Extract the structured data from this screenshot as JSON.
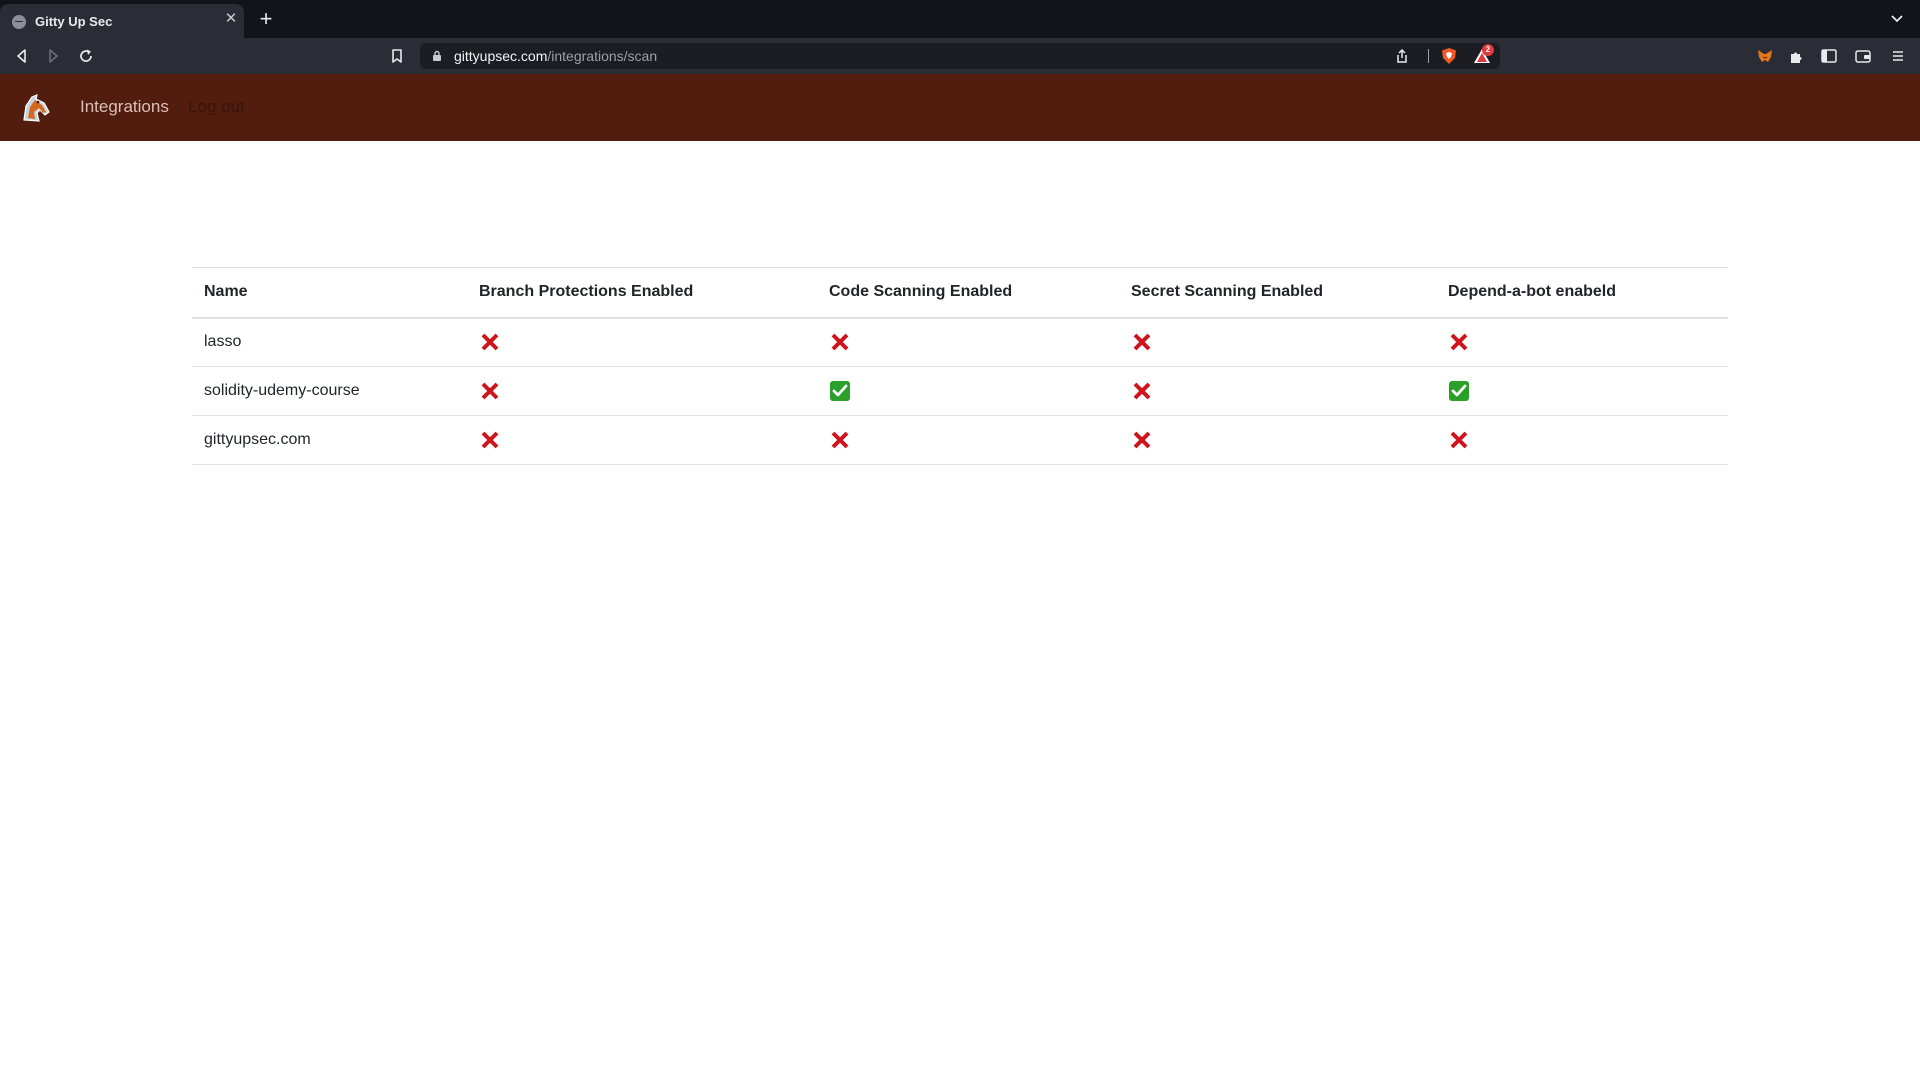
{
  "browser": {
    "tab_title": "Gitty Up Sec",
    "url_host": "gittyupsec.com",
    "url_path": "/integrations/scan",
    "rewards_badge": "2"
  },
  "nav": {
    "integrations_label": "Integrations",
    "logout_label": "Log out"
  },
  "table": {
    "headers": [
      "Name",
      "Branch Protections Enabled",
      "Code Scanning Enabled",
      "Secret Scanning Enabled",
      "Depend-a-bot enabeld"
    ],
    "rows": [
      {
        "name": "lasso",
        "branch_protections": false,
        "code_scanning": false,
        "secret_scanning": false,
        "dependabot": false
      },
      {
        "name": "solidity-udemy-course",
        "branch_protections": false,
        "code_scanning": true,
        "secret_scanning": false,
        "dependabot": true
      },
      {
        "name": "gittyupsec.com",
        "branch_protections": false,
        "code_scanning": false,
        "secret_scanning": false,
        "dependabot": false
      }
    ]
  },
  "colors": {
    "nav_bg": "#521c0e",
    "fail": "#d0141c",
    "pass": "#2aa02a"
  },
  "icons": {
    "fail": "cross-mark-icon",
    "pass": "check-mark-icon"
  }
}
